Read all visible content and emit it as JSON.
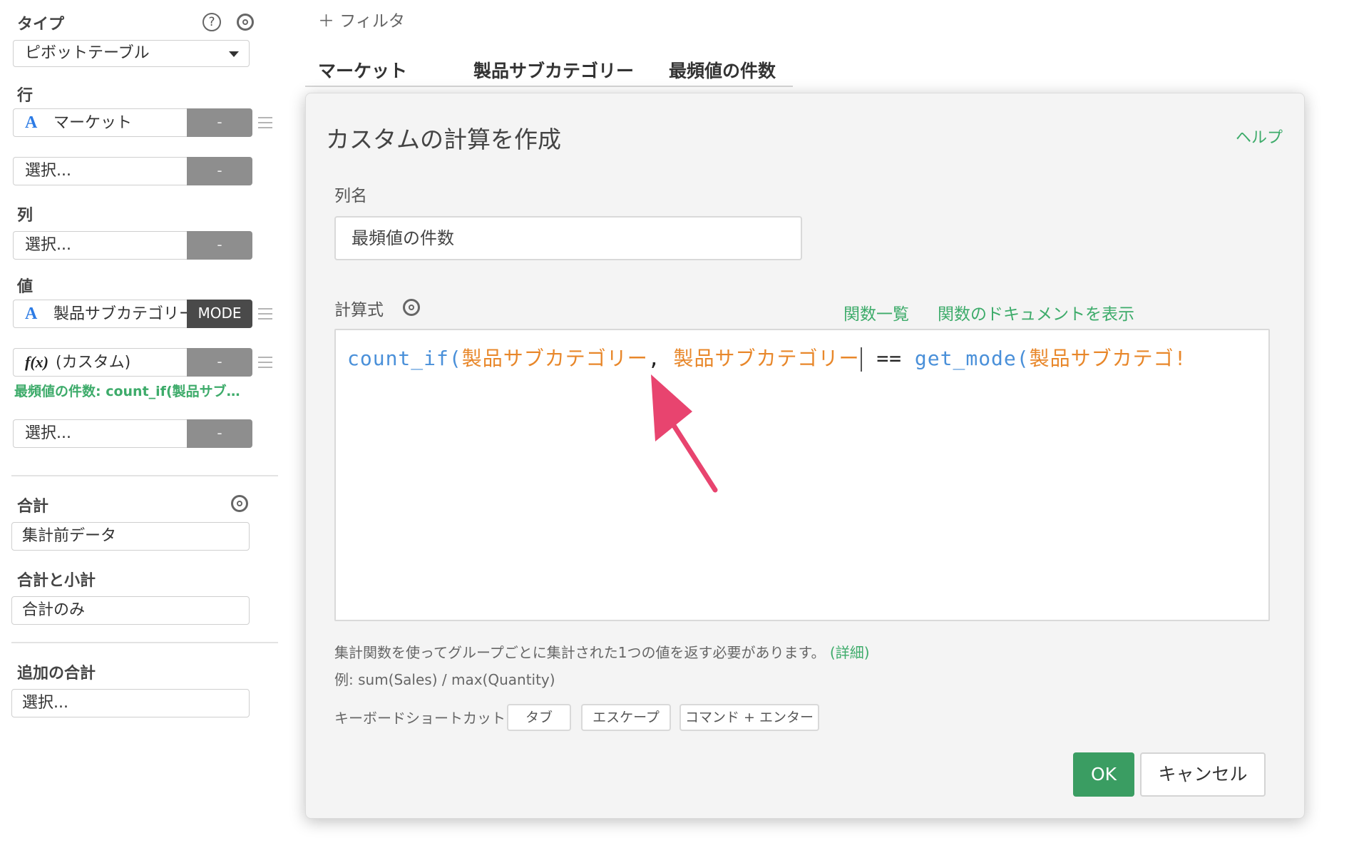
{
  "sidebar": {
    "type_label": "タイプ",
    "type_value": "ピボットテーブル",
    "rows_label": "行",
    "rows_field": "マーケット",
    "rows_select": "選択...",
    "cols_label": "列",
    "cols_select": "選択...",
    "values_label": "値",
    "value_field": "製品サブカテゴリー",
    "value_agg": "MODE",
    "custom_icon": "f(x)",
    "custom_field": "(カスタム)",
    "custom_caption": "最頻値の件数: count_if(製品サブ…",
    "values_select": "選択...",
    "remove_label": "-",
    "total_label": "合計",
    "total_value": "集計前データ",
    "subtotal_label": "合計と小計",
    "subtotal_value": "合計のみ",
    "extra_total_label": "追加の合計",
    "extra_total_value": "選択..."
  },
  "top": {
    "filter": "＋ フィルタ",
    "columns": [
      "マーケット",
      "製品サブカテゴリー",
      "最頻値の件数"
    ]
  },
  "dialog": {
    "title": "カスタムの計算を作成",
    "help": "ヘルプ",
    "column_name_label": "列名",
    "column_name_value": "最頻値の件数",
    "formula_label": "計算式",
    "functions_link": "関数一覧",
    "docs_link": "関数のドキュメントを表示",
    "code": {
      "fn1": "count_if(",
      "arg1": "製品サブカテゴリー",
      "comma": ", ",
      "arg2": "製品サブカテゴリー",
      "op": " == ",
      "fn2": "get_mode(",
      "arg3": "製品サブカテゴ!"
    },
    "note": "集計関数を使ってグループごとに集計された1つの値を返す必要があります。",
    "note_link": "(詳細)",
    "example": "例: sum(Sales) / max(Quantity)",
    "shortcut_label": "キーボードショートカット:",
    "shortcuts": [
      "タブ",
      "エスケープ",
      "コマンド + エンター"
    ],
    "ok": "OK",
    "cancel": "キャンセル"
  },
  "colors": {
    "accent_green": "#3a9d62",
    "function_blue": "#4a90d9",
    "column_orange": "#e8872a",
    "arrow_pink": "#e8446f"
  }
}
